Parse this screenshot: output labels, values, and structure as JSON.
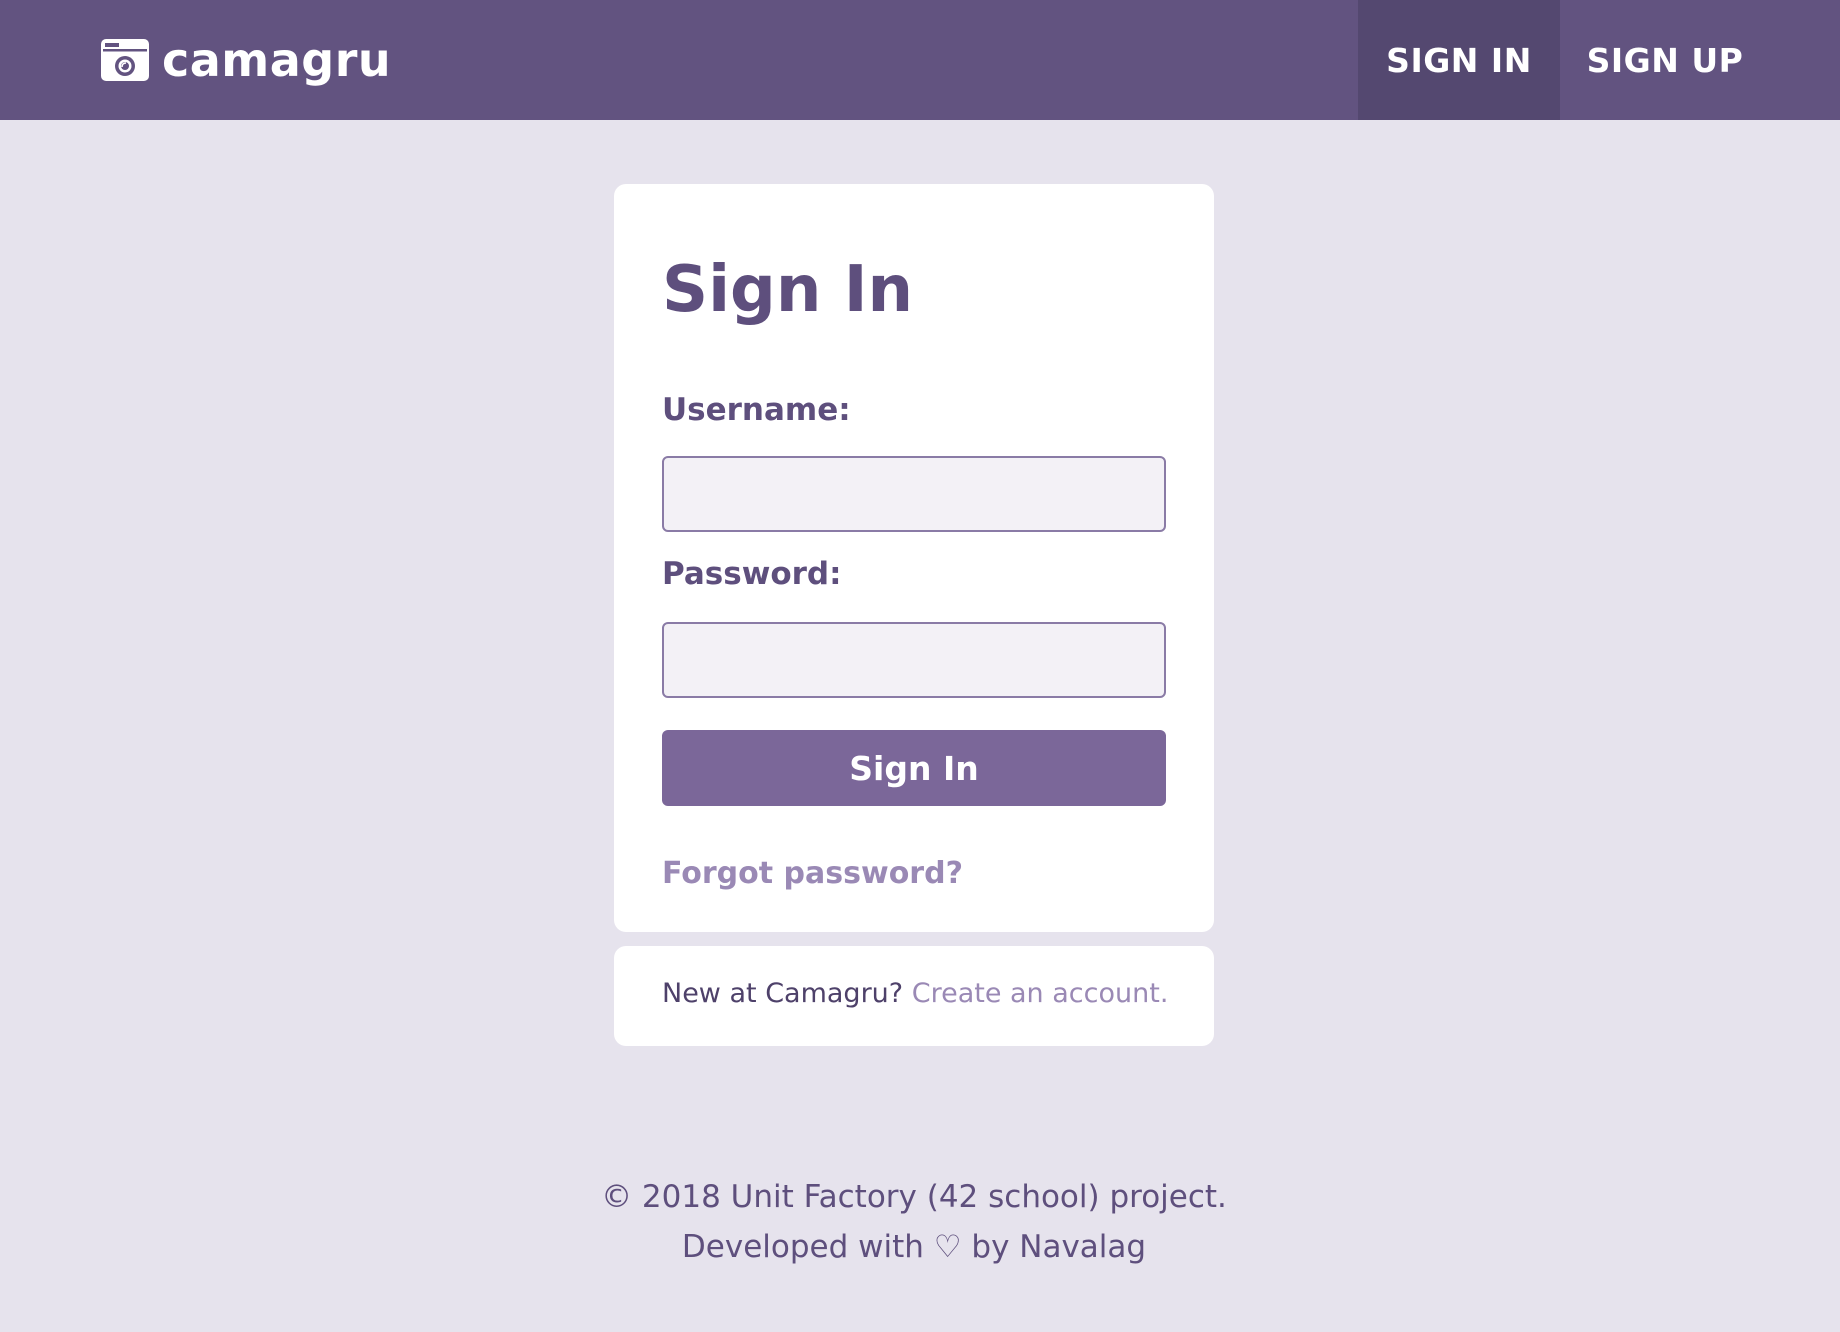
{
  "header": {
    "brand_name": "camagru",
    "brand_icon": "camera-icon",
    "nav": [
      {
        "label": "SIGN IN",
        "active": true
      },
      {
        "label": "SIGN UP",
        "active": false
      }
    ]
  },
  "signin_card": {
    "title": "Sign In",
    "username_label": "Username:",
    "username_value": "",
    "password_label": "Password:",
    "password_value": "",
    "submit_label": "Sign In",
    "forgot_label": "Forgot password?"
  },
  "register_card": {
    "prompt": "New at Camagru?",
    "link_label": "Create an account."
  },
  "footer": {
    "line1": "© 2018 Unit Factory (42 school) project.",
    "line2": "Developed with ♡ by Navalag"
  },
  "colors": {
    "header_bg": "#625380",
    "nav_active_bg": "#544870",
    "page_bg": "#e6e3ed",
    "primary_button": "#7b6799",
    "link": "#9a89b5",
    "text": "#5e4f7d"
  }
}
